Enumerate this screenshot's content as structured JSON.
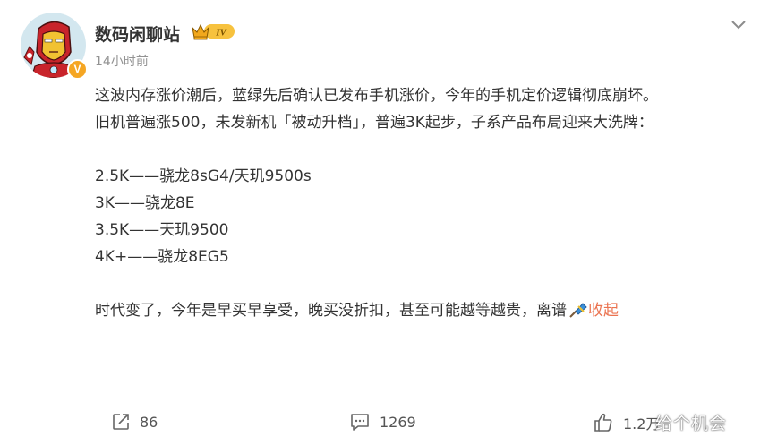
{
  "post": {
    "author": "数码闲聊站",
    "member_level": "IV",
    "verified_badge": "V",
    "time": "14小时前",
    "paragraphs": [
      "这波内存涨价潮后，蓝绿先后确认已发布手机涨价，今年的手机定价逻辑彻底崩坏。",
      "旧机普遍涨500，未发新机「被动升档」，普遍3K起步，子系产品布局迎来大洗牌：",
      "",
      "2.5K——骁龙8sG4/天玑9500s",
      "3K——骁龙8E",
      "3.5K——天玑9500",
      "4K+——骁龙8EG5",
      "",
      "时代变了，今年是早买早享受，晚买没折扣，甚至可能越等越贵，离谱"
    ],
    "collapse_label": "收起"
  },
  "actions": {
    "repost_count": "86",
    "comment_count": "1269",
    "like_count": "1.2万"
  },
  "watermark": "给个机会",
  "icons": {
    "repost": "repost-icon",
    "comment": "comment-icon",
    "like": "thumbs-up-icon",
    "more": "chevron-down-icon",
    "emoji": "lark-emoji-icon",
    "member": "crown-badge-icon"
  },
  "colors": {
    "link": "#eb7350",
    "muted": "#939393",
    "text": "#333333"
  }
}
